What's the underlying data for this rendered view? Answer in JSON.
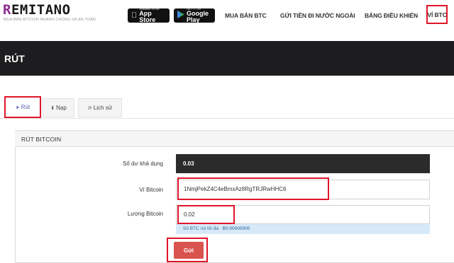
{
  "brand": {
    "logo_first": "R",
    "logo_rest": "EMITANO",
    "tagline": "MUA BÁN BITCOIN NHANH CHÓNG VÀ AN TOÀN"
  },
  "stores": {
    "apple": {
      "small": "Available on the",
      "big": "App Store",
      "icon": "apple-icon"
    },
    "google": {
      "small": "GET IT ON",
      "big": "Google Play",
      "icon": "google-play-icon"
    }
  },
  "nav": {
    "buy": "MUA BÁN BTC",
    "send_abroad": "GỬI TIỀN ĐI NƯỚC NGOÀI",
    "dashboard": "BẢNG ĐIỀU KHIỂN",
    "wallet": "VÍ BTC"
  },
  "header": {
    "title": "RÚT"
  },
  "tabs": [
    {
      "label": "Rút",
      "icon": "send-icon",
      "active": true
    },
    {
      "label": "Nạp",
      "icon": "download-icon",
      "active": false
    },
    {
      "label": "Lịch sử",
      "icon": "history-icon",
      "active": false
    }
  ],
  "panel": {
    "title": "RÚT BITCOIN"
  },
  "form": {
    "balance_label": "Số dư khả dụng",
    "balance_value": "0.03",
    "address_label": "Ví Bitcoin",
    "address_value": "1NmjPekZ4C4eBmxAz8RgTRJRwHHC6",
    "amount_label": "Lượng Bitcoin",
    "amount_value": "0.02",
    "hint_label": "Số BTC rút tối đa:",
    "hint_value": "B0.00000000",
    "submit_label": "Gửi"
  },
  "colors": {
    "highlight": "#e0152a",
    "brand_accent": "#8a2d8f",
    "dark_header": "#1d1d1f",
    "submit_button": "#d9534f",
    "hint_bg": "#d7e9f8"
  }
}
